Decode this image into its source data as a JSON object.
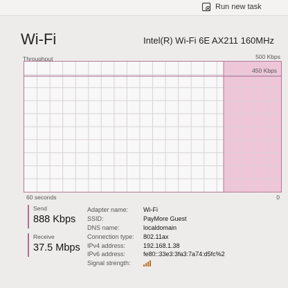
{
  "header": {
    "run_task_label": "Run new task",
    "run_task_icon": "task-icon"
  },
  "page": {
    "title": "Wi-Fi",
    "adapter": "Intel(R) Wi-Fi 6E AX211 160MHz"
  },
  "graph": {
    "label": "Throughput",
    "max_label": "500 Kbps",
    "current_label": "450 Kbps",
    "x_left": "60 seconds",
    "x_right": "0",
    "accent_color": "#b07896",
    "fill_color": "#efc5d8"
  },
  "stats": {
    "send_label": "Send",
    "send_value": "888 Kbps",
    "receive_label": "Receive",
    "receive_value": "37.5 Mbps"
  },
  "details": [
    {
      "key": "Adapter name:",
      "value": "Wi-Fi"
    },
    {
      "key": "SSID:",
      "value": "PayMore Guest"
    },
    {
      "key": "DNS name:",
      "value": "localdomain"
    },
    {
      "key": "Connection type:",
      "value": "802.11ax"
    },
    {
      "key": "IPv4 address:",
      "value": "192.168.1.38"
    },
    {
      "key": "IPv6 address:",
      "value": "fe80::33e3:3fa3:7a74:d5fc%2"
    },
    {
      "key": "Signal strength:",
      "value": ""
    }
  ],
  "signal": {
    "bars_shown": 4,
    "color": "#b8732c"
  }
}
